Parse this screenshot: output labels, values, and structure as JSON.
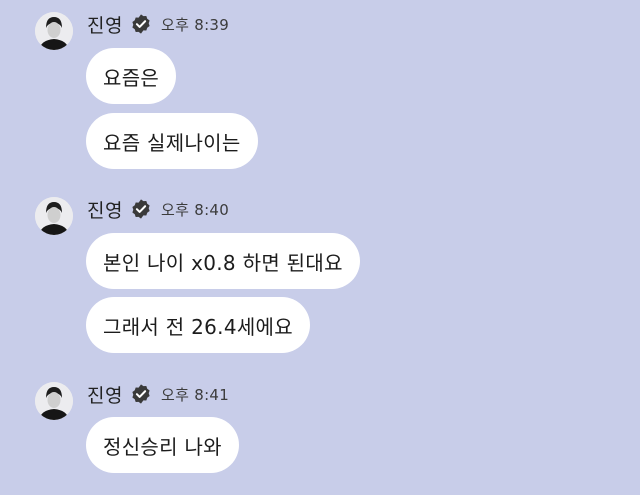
{
  "chat": {
    "groups": [
      {
        "sender": "진영",
        "time": "오후 8:39",
        "messages": [
          "요즘은",
          "요즘 실제나이는"
        ]
      },
      {
        "sender": "진영",
        "time": "오후 8:40",
        "messages": [
          "본인 나이 x0.8 하면 된대요",
          "그래서 전 26.4세에요"
        ]
      },
      {
        "sender": "진영",
        "time": "오후 8:41",
        "messages": [
          "정신승리 나와"
        ]
      }
    ]
  },
  "colors": {
    "background": "#c8cde9",
    "bubble": "#ffffff",
    "badge": "#3a3a3a"
  },
  "icons": {
    "avatar": "profile-photo",
    "badge": "verified-badge-icon"
  }
}
